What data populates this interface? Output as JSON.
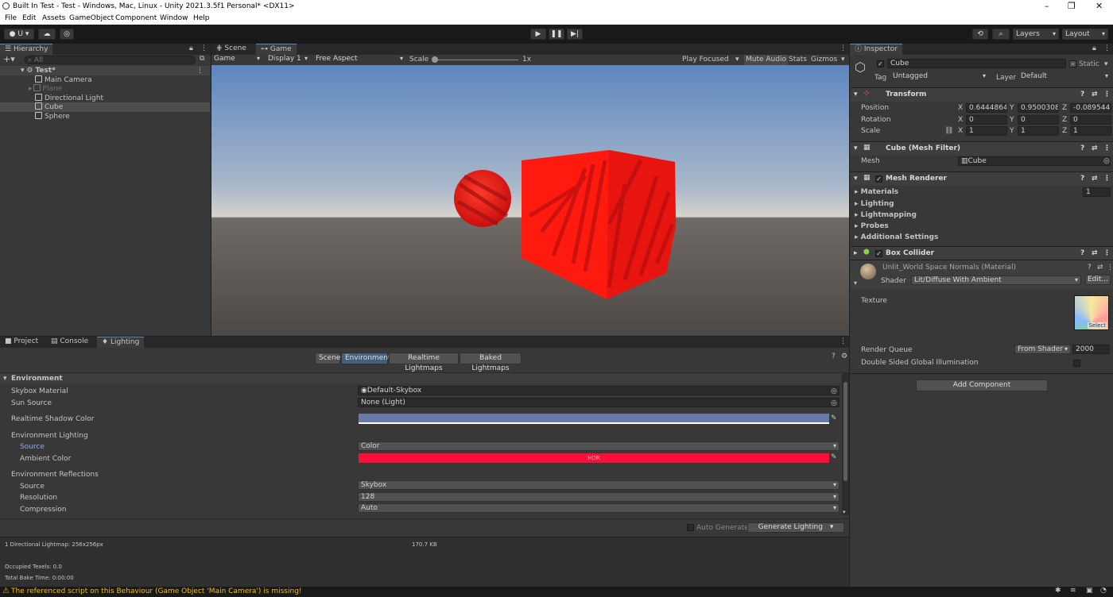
{
  "window": {
    "title": "Built In Test - Test - Windows, Mac, Linux - Unity 2021.3.5f1 Personal* <DX11>",
    "controls": [
      "–",
      "❐",
      "✕"
    ]
  },
  "menu": [
    "File",
    "Edit",
    "Assets",
    "GameObject",
    "Component",
    "Window",
    "Help"
  ],
  "toolbar": {
    "account_label": "U ▾",
    "layers_label": "Layers",
    "layout_label": "Layout"
  },
  "hierarchy": {
    "tab_label": "Hierarchy",
    "search_placeholder": "All",
    "scene_name": "Test*",
    "items": [
      {
        "label": "Main Camera",
        "dimmed": false,
        "selected": false
      },
      {
        "label": "Plane",
        "dimmed": true,
        "selected": false
      },
      {
        "label": "Directional Light",
        "dimmed": false,
        "selected": false
      },
      {
        "label": "Cube",
        "dimmed": false,
        "selected": true
      },
      {
        "label": "Sphere",
        "dimmed": false,
        "selected": false
      }
    ]
  },
  "game_view": {
    "tabs": [
      "Scene",
      "Game"
    ],
    "mode": "Game",
    "display": "Display 1",
    "aspect": "Free Aspect",
    "scale_label": "Scale",
    "scale_value": "1x",
    "toggles": [
      "Play Focused",
      "Mute Audio",
      "Stats",
      "Gizmos"
    ]
  },
  "bottom_tabs": [
    "Project",
    "Console",
    "Lighting"
  ],
  "lighting": {
    "subtabs": [
      "Scene",
      "Environment",
      "Realtime Lightmaps",
      "Baked Lightmaps"
    ],
    "section_title": "Environment",
    "skybox_label": "Skybox Material",
    "skybox_value": "Default-Skybox",
    "sun_label": "Sun Source",
    "sun_value": "None (Light)",
    "shadow_color_label": "Realtime Shadow Color",
    "env_lighting_label": "Environment Lighting",
    "source_label": "Source",
    "source_value": "Color",
    "ambient_label": "Ambient Color",
    "hdr_text": "HDR",
    "env_reflections_label": "Environment Reflections",
    "refl_source_label": "Source",
    "refl_source_value": "Skybox",
    "resolution_label": "Resolution",
    "resolution_value": "128",
    "compression_label": "Compression",
    "compression_value": "Auto",
    "auto_generate_label": "Auto Generate",
    "generate_button": "Generate Lighting",
    "stats_lightmap": "1 Directional Lightmap: 256x256px",
    "stats_size": "170.7 KB",
    "stats_texels": "Occupied Texels: 0.0",
    "stats_bake_time": "Total Bake Time: 0:00:00",
    "shadow_color": "#6a7aa8",
    "ambient_color": "#ff0d3a"
  },
  "inspector": {
    "tab_label": "Inspector",
    "object_name": "Cube",
    "static_label": "Static",
    "tag_label": "Tag",
    "tag_value": "Untagged",
    "layer_label": "Layer",
    "layer_value": "Default",
    "transform": {
      "title": "Transform",
      "position_label": "Position",
      "rotation_label": "Rotation",
      "scale_label": "Scale",
      "position": [
        "0.6444864",
        "0.9500308",
        "-0.089544"
      ],
      "rotation": [
        "0",
        "0",
        "0"
      ],
      "scale": [
        "1",
        "1",
        "1"
      ],
      "axis_x": "X",
      "axis_y": "Y",
      "axis_z": "Z"
    },
    "mesh_filter": {
      "title": "Cube (Mesh Filter)",
      "mesh_label": "Mesh",
      "mesh_value": "Cube"
    },
    "mesh_renderer": {
      "title": "Mesh Renderer",
      "materials_label": "Materials",
      "materials_count": "1",
      "sections": [
        "Lighting",
        "Lightmapping",
        "Probes",
        "Additional Settings"
      ]
    },
    "box_collider": {
      "title": "Box Collider"
    },
    "material": {
      "name": "Unlit_World Space Normals (Material)",
      "shader_label": "Shader",
      "shader_value": "Lit/Diffuse With Ambient",
      "edit_label": "Edit...",
      "texture_label": "Texture",
      "select_label": "Select",
      "render_queue_label": "Render Queue",
      "render_queue_mode": "From Shader",
      "render_queue_value": "2000",
      "double_sided_label": "Double Sided Global Illumination"
    },
    "add_component": "Add Component"
  },
  "status_bar": {
    "message": "The referenced script on this Behaviour (Game Object 'Main Camera') is missing!",
    "warning_color": "#f4bc02"
  }
}
